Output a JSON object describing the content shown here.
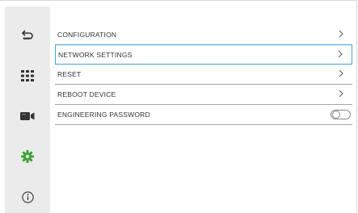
{
  "sidebar": {
    "items": [
      {
        "icon": "back-arrow-icon"
      },
      {
        "icon": "keypad-grid-icon"
      },
      {
        "icon": "video-camera-icon"
      },
      {
        "icon": "settings-gear-icon",
        "active": true,
        "color": "#3aa335"
      },
      {
        "icon": "info-icon"
      }
    ]
  },
  "menu": {
    "items": [
      {
        "label": "CONFIGURATION"
      },
      {
        "label": "NETWORK SETTINGS"
      },
      {
        "label": "RESET"
      },
      {
        "label": "REBOOT DEVICE"
      },
      {
        "label": "ENGINEERING PASSWORD"
      }
    ],
    "engineering_password_enabled": false
  },
  "colors": {
    "selection_border": "#3fa1e0",
    "sidebar_bg": "#ebebeb",
    "icon": "#333333",
    "active_icon": "#3aa335"
  }
}
